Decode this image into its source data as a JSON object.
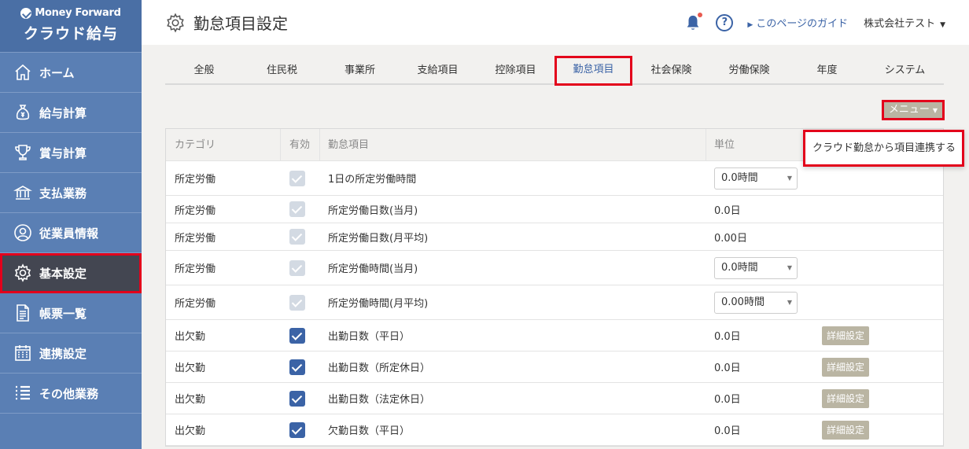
{
  "brand": {
    "company": "Money Forward",
    "product": "クラウド給与"
  },
  "sidebar": {
    "items": [
      {
        "label": "ホーム",
        "icon": "home-icon"
      },
      {
        "label": "給与計算",
        "icon": "money-bag-icon"
      },
      {
        "label": "賞与計算",
        "icon": "trophy-icon"
      },
      {
        "label": "支払業務",
        "icon": "bank-icon"
      },
      {
        "label": "従業員情報",
        "icon": "person-icon"
      },
      {
        "label": "基本設定",
        "icon": "gear-icon"
      },
      {
        "label": "帳票一覧",
        "icon": "document-icon"
      },
      {
        "label": "連携設定",
        "icon": "calendar-icon"
      },
      {
        "label": "その他業務",
        "icon": "list-icon"
      }
    ],
    "active_index": 5
  },
  "header": {
    "title": "勤怠項目設定",
    "help": "?",
    "guide": "このページのガイド",
    "company": "株式会社テスト"
  },
  "tabs": [
    {
      "label": "全般"
    },
    {
      "label": "住民税"
    },
    {
      "label": "事業所"
    },
    {
      "label": "支給項目"
    },
    {
      "label": "控除項目"
    },
    {
      "label": "勤怠項目",
      "active": true
    },
    {
      "label": "社会保険"
    },
    {
      "label": "労働保険"
    },
    {
      "label": "年度"
    },
    {
      "label": "システム"
    }
  ],
  "menu": {
    "label": "メニュー",
    "options": [
      "クラウド勤怠から項目連携する"
    ]
  },
  "table": {
    "columns": {
      "category": "カテゴリ",
      "enabled": "有効",
      "item": "勤怠項目",
      "unit": "単位"
    },
    "rows": [
      {
        "category": "所定労働",
        "enabled": "disabled",
        "item": "1日の所定労働時間",
        "unit": "0.0時間",
        "unit_type": "select"
      },
      {
        "category": "所定労働",
        "enabled": "disabled",
        "item": "所定労働日数(当月)",
        "unit": "0.0日",
        "unit_type": "text"
      },
      {
        "category": "所定労働",
        "enabled": "disabled",
        "item": "所定労働日数(月平均)",
        "unit": "0.00日",
        "unit_type": "text"
      },
      {
        "category": "所定労働",
        "enabled": "disabled",
        "item": "所定労働時間(当月)",
        "unit": "0.0時間",
        "unit_type": "select"
      },
      {
        "category": "所定労働",
        "enabled": "disabled",
        "item": "所定労働時間(月平均)",
        "unit": "0.00時間",
        "unit_type": "select"
      },
      {
        "category": "出欠勤",
        "enabled": "checked",
        "item": "出勤日数（平日）",
        "unit": "0.0日",
        "unit_type": "text",
        "action": "詳細設定"
      },
      {
        "category": "出欠勤",
        "enabled": "checked",
        "item": "出勤日数（所定休日）",
        "unit": "0.0日",
        "unit_type": "text",
        "action": "詳細設定"
      },
      {
        "category": "出欠勤",
        "enabled": "checked",
        "item": "出勤日数（法定休日）",
        "unit": "0.0日",
        "unit_type": "text",
        "action": "詳細設定"
      },
      {
        "category": "出欠勤",
        "enabled": "checked",
        "item": "欠勤日数（平日）",
        "unit": "0.0日",
        "unit_type": "text",
        "action": "詳細設定"
      }
    ]
  }
}
